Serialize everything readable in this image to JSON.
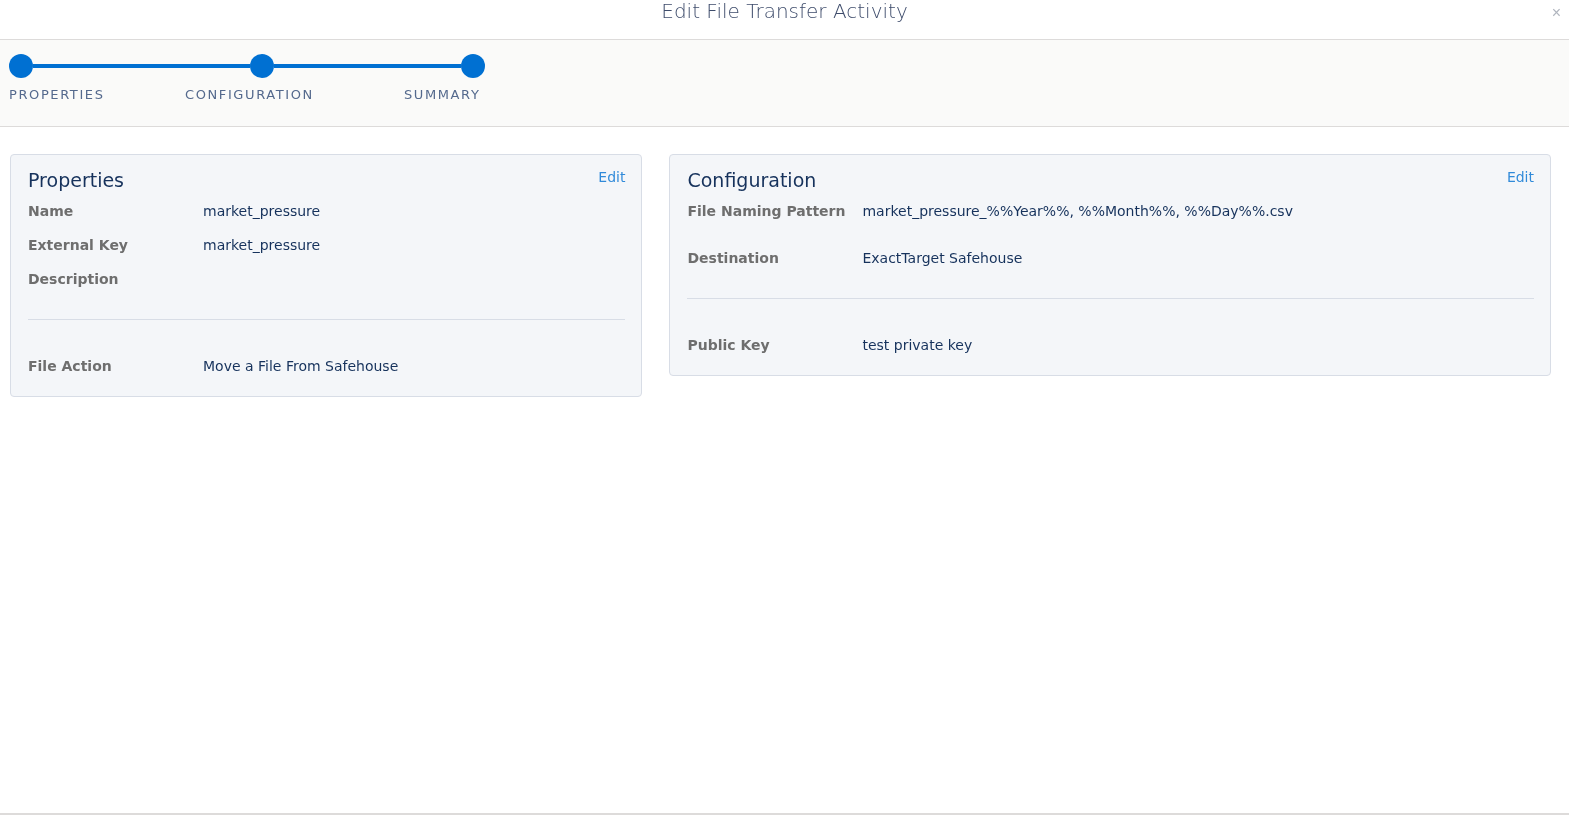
{
  "modal": {
    "title": "Edit File Transfer Activity",
    "close": "×"
  },
  "steps": [
    {
      "label": "PROPERTIES"
    },
    {
      "label": "CONFIGURATION"
    },
    {
      "label": "SUMMARY"
    }
  ],
  "cards": [
    {
      "title": "Properties",
      "edit": "Edit",
      "groups": [
        [
          {
            "label": "Name",
            "value": "market_pressure"
          },
          {
            "label": "External Key",
            "value": "market_pressure"
          },
          {
            "label": "Description"
          }
        ],
        [
          {
            "label": "File Action",
            "value": "Move a File From Safehouse"
          }
        ]
      ]
    },
    {
      "title": "Configuration",
      "edit": "Edit",
      "groups": [
        [
          {
            "label": "File Naming Pattern",
            "value": "market_pressure_%%Year%%, %%Month%%, %%Day%%.csv"
          },
          {
            "label": "Destination",
            "value": "ExactTarget Safehouse"
          }
        ],
        [
          {
            "label": "Public Key",
            "value": "test private key"
          }
        ]
      ]
    }
  ]
}
